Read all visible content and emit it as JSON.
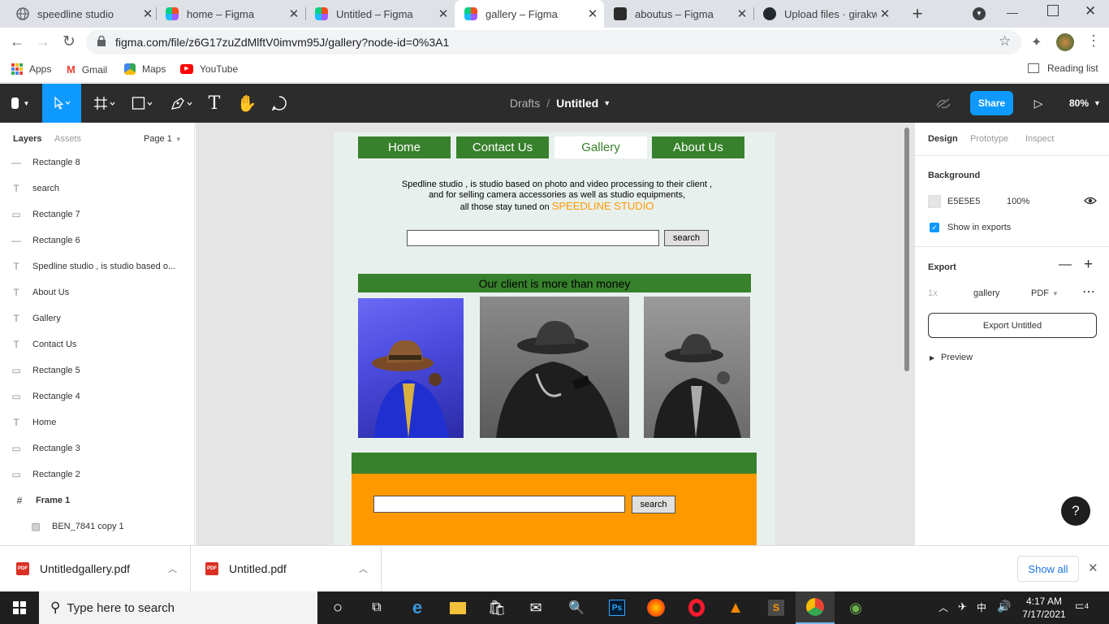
{
  "browser": {
    "tabs": [
      {
        "title": "speedline studio"
      },
      {
        "title": "home – Figma"
      },
      {
        "title": "Untitled – Figma"
      },
      {
        "title": "gallery – Figma"
      },
      {
        "title": "aboutus – Figma"
      },
      {
        "title": "Upload files · girakwiz"
      }
    ],
    "url": "figma.com/file/z6G17zuZdMlftV0imvm95J/gallery?node-id=0%3A1",
    "bookmarks": [
      "Apps",
      "Gmail",
      "Maps",
      "YouTube"
    ],
    "reading_list": "Reading list"
  },
  "figma": {
    "breadcrumb_parent": "Drafts",
    "breadcrumb_sep": "/",
    "file_name": "Untitled",
    "share": "Share",
    "zoom": "80%",
    "left_tabs": [
      "Layers",
      "Assets"
    ],
    "page": "Page 1",
    "layers": [
      {
        "name": "Rectangle 8",
        "icon": "—"
      },
      {
        "name": "search",
        "icon": "T"
      },
      {
        "name": "Rectangle 7",
        "icon": "▭"
      },
      {
        "name": "Rectangle 6",
        "icon": "—"
      },
      {
        "name": "Spedline studio , is studio based o...",
        "icon": "T"
      },
      {
        "name": "About Us",
        "icon": "T"
      },
      {
        "name": "Gallery",
        "icon": "T"
      },
      {
        "name": "Contact Us",
        "icon": "T"
      },
      {
        "name": "Rectangle 5",
        "icon": "▭"
      },
      {
        "name": "Rectangle 4",
        "icon": "▭"
      },
      {
        "name": "Home",
        "icon": "T"
      },
      {
        "name": "Rectangle 3",
        "icon": "▭"
      },
      {
        "name": "Rectangle 2",
        "icon": "▭"
      },
      {
        "name": "Frame 1",
        "icon": "#"
      },
      {
        "name": "BEN_7841 copy 1",
        "icon": "▨"
      }
    ],
    "right_tabs": [
      "Design",
      "Prototype",
      "Inspect"
    ],
    "background_label": "Background",
    "bg_color_hex": "E5E5E5",
    "bg_opacity": "100%",
    "show_in_exports": "Show in exports",
    "export_label": "Export",
    "export_scale": "1x",
    "export_suffix": "gallery",
    "export_format": "PDF",
    "export_button": "Export Untitled",
    "preview": "Preview",
    "help": "?"
  },
  "design": {
    "nav": [
      "Home",
      "Contact Us",
      "Gallery",
      "About Us"
    ],
    "intro_line1": "Spedline studio , is studio based on photo and video processing to their client ,",
    "intro_line2": "and for selling camera accessories as well as studio equipments,",
    "intro_line3": "all those stay tuned on",
    "brand": "SPEEDLINE STUDIO",
    "search_button": "search",
    "banner": "Our client  is more than money",
    "search_button_2": "search"
  },
  "downloads": {
    "items": [
      "Untitledgallery.pdf",
      "Untitled.pdf"
    ],
    "show_all": "Show all"
  },
  "taskbar": {
    "search_placeholder": "Type here to search",
    "time": "4:17 AM",
    "date": "7/17/2021",
    "notifications": "4"
  },
  "colors": {
    "accent_green": "#38812c",
    "orange": "#ff9900",
    "figma_blue": "#0d99ff",
    "frame_bg": "#e8f0ee"
  }
}
